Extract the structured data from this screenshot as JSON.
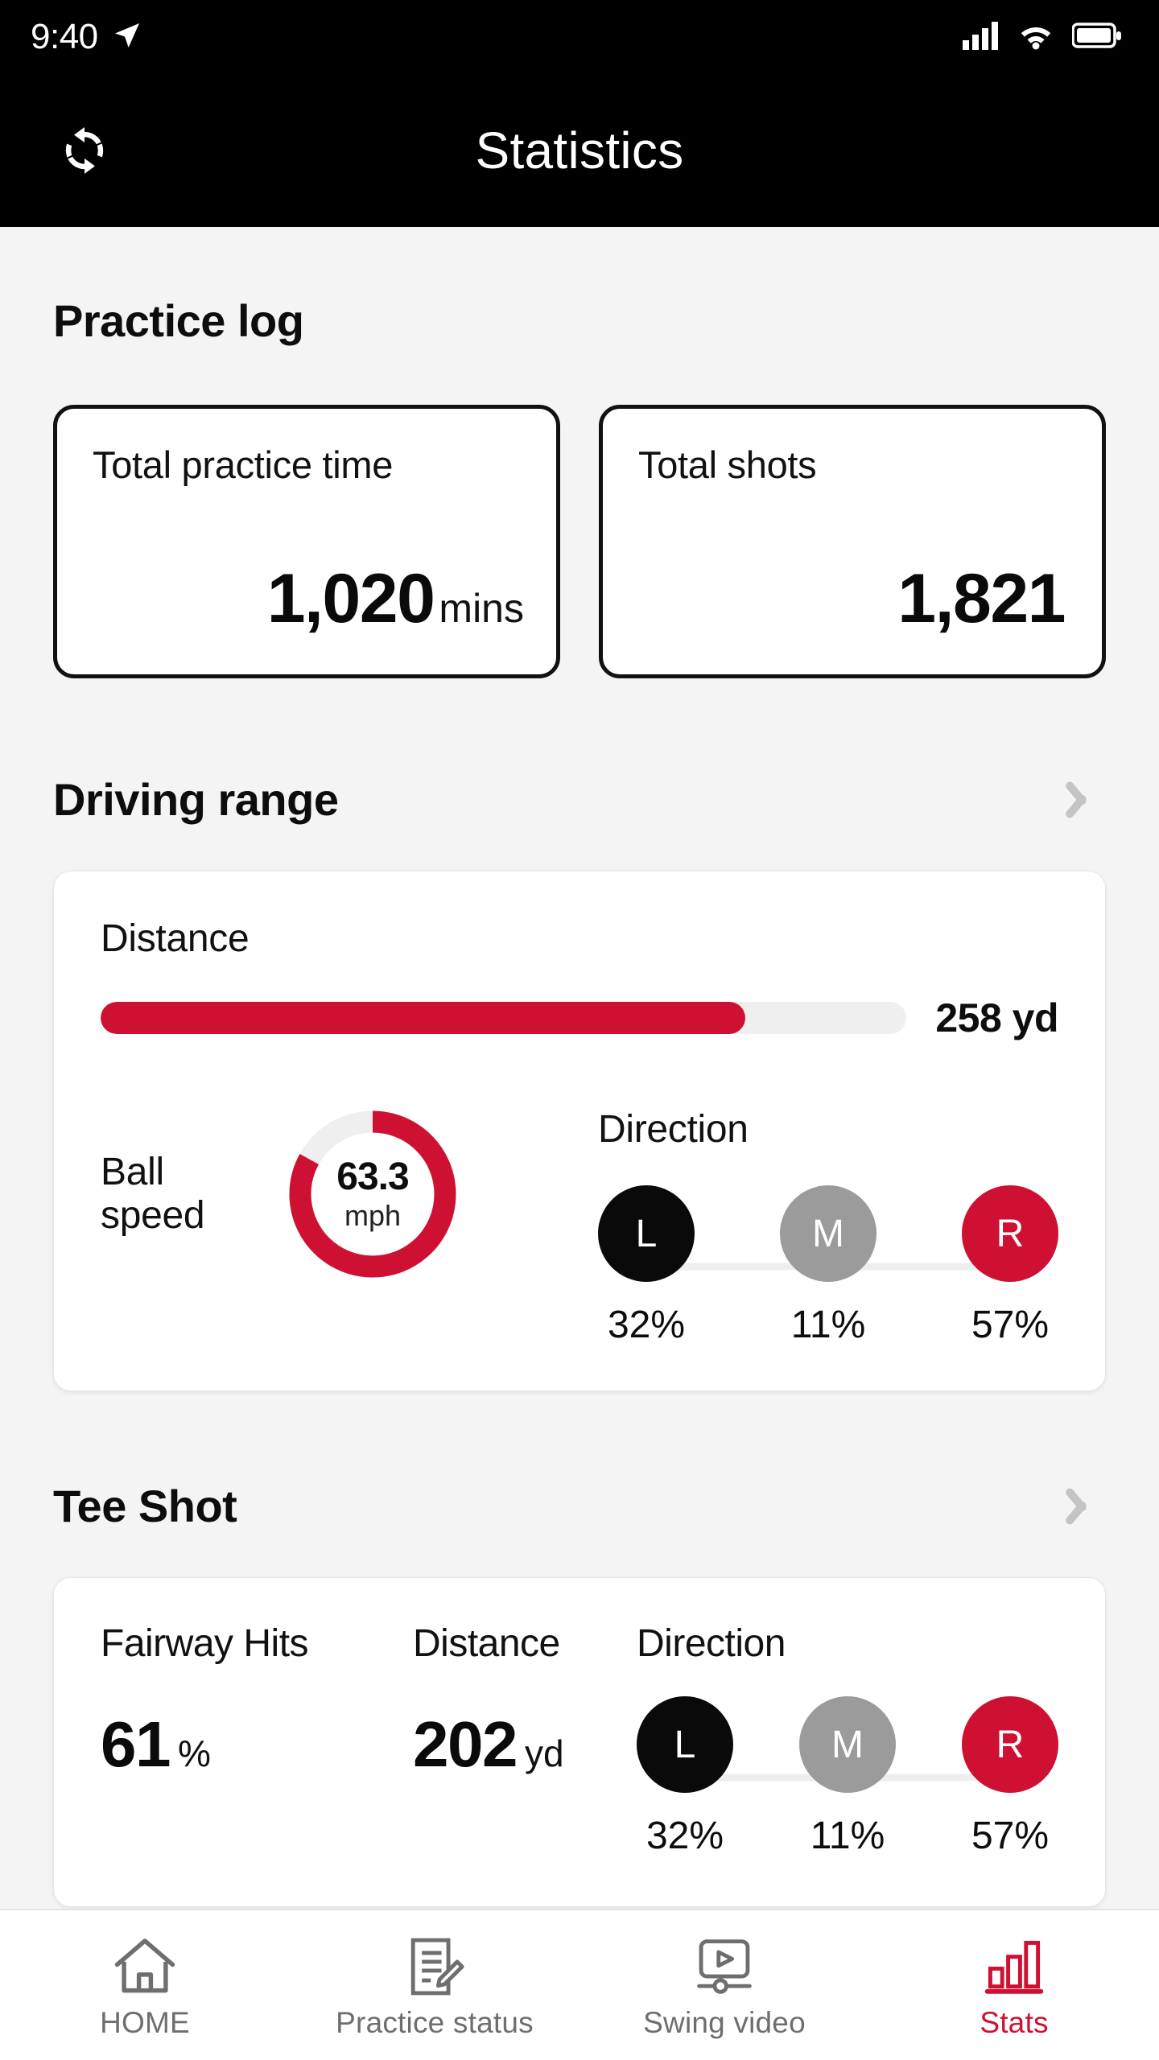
{
  "statusbar": {
    "time": "9:40",
    "location_icon": "navigation-arrow-icon",
    "signal_icon": "cellular-signal-icon",
    "wifi_icon": "wifi-icon",
    "battery_icon": "battery-full-icon"
  },
  "header": {
    "title": "Statistics",
    "sync_icon": "sync-refresh-icon"
  },
  "practice_log": {
    "title": "Practice log",
    "cards": [
      {
        "label": "Total practice time",
        "value": "1,020",
        "unit": "mins"
      },
      {
        "label": "Total shots",
        "value": "1,821",
        "unit": ""
      }
    ]
  },
  "driving_range": {
    "title": "Driving range",
    "chevron_icon": "chevron-right-icon",
    "distance": {
      "label": "Distance",
      "value": "258 yd",
      "fill_percent": 80
    },
    "ball_speed": {
      "label": "Ball\nspeed",
      "label_line1": "Ball",
      "label_line2": "speed",
      "value": "63.3",
      "unit": "mph",
      "gauge_percent": 83
    },
    "direction": {
      "title": "Direction",
      "items": [
        {
          "key": "L",
          "pct": "32%",
          "color": "#0a0a0a"
        },
        {
          "key": "M",
          "pct": "11%",
          "color": "#9b9b9b"
        },
        {
          "key": "R",
          "pct": "57%",
          "color": "#ce1133"
        }
      ]
    }
  },
  "tee_shot": {
    "title": "Tee Shot",
    "chevron_icon": "chevron-right-icon",
    "fairway_hits": {
      "label": "Fairway Hits",
      "value": "61",
      "unit": "%"
    },
    "distance": {
      "label": "Distance",
      "value": "202",
      "unit": "yd"
    },
    "direction": {
      "title": "Direction",
      "items": [
        {
          "key": "L",
          "pct": "32%",
          "color": "#0a0a0a"
        },
        {
          "key": "M",
          "pct": "11%",
          "color": "#9b9b9b"
        },
        {
          "key": "R",
          "pct": "57%",
          "color": "#ce1133"
        }
      ]
    }
  },
  "bottom_nav": {
    "items": [
      {
        "label": "HOME",
        "icon": "home-icon",
        "active": false
      },
      {
        "label": "Practice status",
        "icon": "document-pencil-icon",
        "active": false
      },
      {
        "label": "Swing video",
        "icon": "video-player-icon",
        "active": false
      },
      {
        "label": "Stats",
        "icon": "bar-chart-icon",
        "active": true
      }
    ]
  },
  "colors": {
    "accent_red": "#ce1133",
    "page_bg": "#f4f4f4",
    "header_bg": "#000000",
    "track_gray": "#efefef",
    "mid_gray": "#9b9b9b"
  }
}
